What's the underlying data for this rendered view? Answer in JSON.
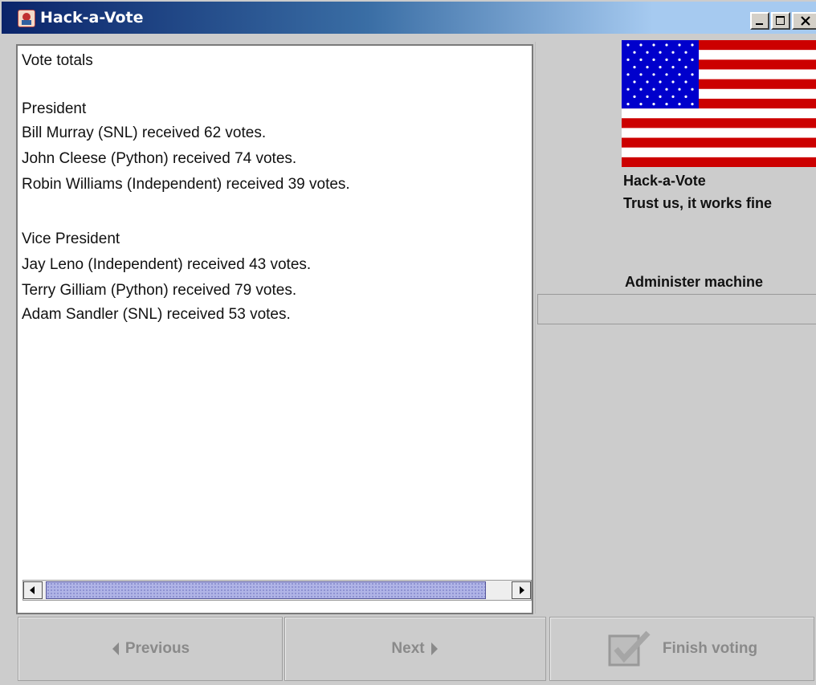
{
  "window": {
    "title": "Hack-a-Vote",
    "controls": [
      "minimize",
      "maximize",
      "close"
    ]
  },
  "results": {
    "lines": [
      "Vote totals",
      "",
      "President",
      "Bill Murray (SNL) received 62 votes.",
      "John Cleese (Python) received 74 votes.",
      "Robin Williams (Independent) received 39 votes.",
      "",
      "Vice President",
      "Jay Leno (Independent) received 43 votes.",
      "Terry Gilliam (Python) received 79 votes.",
      "Adam Sandler (SNL) received 53 votes."
    ]
  },
  "sidebar": {
    "name": "Hack-a-Vote",
    "slogan": "Trust us, it works fine",
    "admin_label": "Administer machine"
  },
  "buttons": {
    "previous": "Previous",
    "next": "Next",
    "finish": "Finish voting"
  },
  "colors": {
    "titlebar_start": "#0a246a",
    "titlebar_end": "#a6caf0",
    "flag_red": "#cc0000",
    "flag_blue": "#0000cc",
    "disabled_text": "#8a8a8a"
  }
}
